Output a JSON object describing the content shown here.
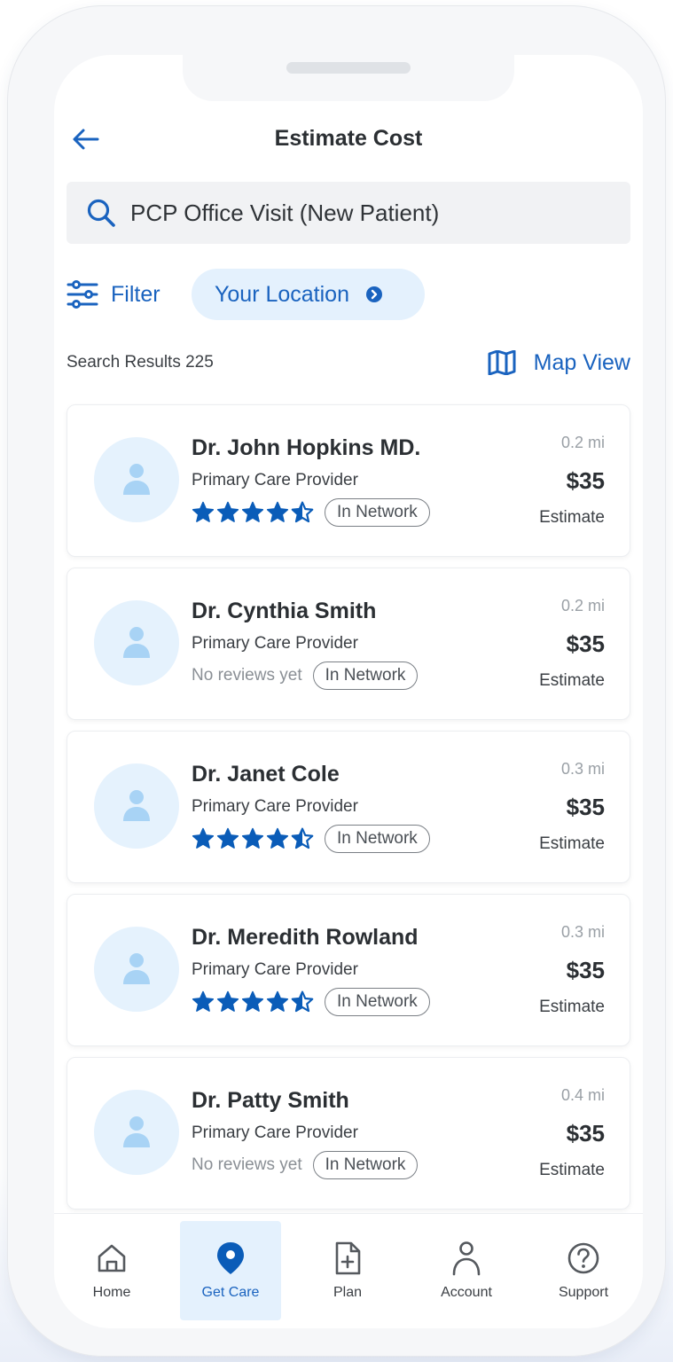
{
  "header": {
    "title": "Estimate Cost"
  },
  "search": {
    "query": "PCP Office Visit (New Patient)"
  },
  "filters": {
    "filter_label": "Filter",
    "location_label": "Your Location"
  },
  "results": {
    "summary": "Search Results 225",
    "map_view_label": "Map View"
  },
  "providers": [
    {
      "name": "Dr. John Hopkins MD.",
      "specialty": "Primary Care Provider",
      "rating": 4.5,
      "review_text": "",
      "network": "In Network",
      "distance": "0.2 mi",
      "price": "$35",
      "price_note": "Estimate"
    },
    {
      "name": "Dr. Cynthia Smith",
      "specialty": "Primary Care Provider",
      "rating": null,
      "review_text": "No reviews yet",
      "network": "In Network",
      "distance": "0.2 mi",
      "price": "$35",
      "price_note": "Estimate"
    },
    {
      "name": "Dr. Janet Cole",
      "specialty": "Primary Care Provider",
      "rating": 4.5,
      "review_text": "",
      "network": "In Network",
      "distance": "0.3 mi",
      "price": "$35",
      "price_note": "Estimate"
    },
    {
      "name": "Dr. Meredith Rowland",
      "specialty": "Primary Care Provider",
      "rating": 4.5,
      "review_text": "",
      "network": "In Network",
      "distance": "0.3 mi",
      "price": "$35",
      "price_note": "Estimate"
    },
    {
      "name": "Dr. Patty Smith",
      "specialty": "Primary Care Provider",
      "rating": null,
      "review_text": "No reviews yet",
      "network": "In Network",
      "distance": "0.4 mi",
      "price": "$35",
      "price_note": "Estimate"
    }
  ],
  "nav": {
    "items": [
      {
        "label": "Home",
        "icon": "home-icon",
        "active": false
      },
      {
        "label": "Get Care",
        "icon": "location-pin-icon",
        "active": true
      },
      {
        "label": "Plan",
        "icon": "document-plus-icon",
        "active": false
      },
      {
        "label": "Account",
        "icon": "person-icon",
        "active": false
      },
      {
        "label": "Support",
        "icon": "question-circle-icon",
        "active": false
      }
    ]
  },
  "colors": {
    "accent": "#1a63bf",
    "star": "#0a5cb8",
    "chip_bg": "#e4f1fd",
    "avatar_bg": "#e5f2fd",
    "avatar_fg": "#a8d3f5"
  }
}
